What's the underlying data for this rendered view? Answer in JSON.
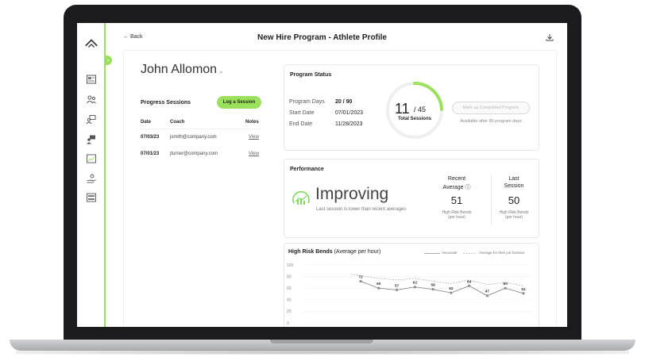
{
  "header": {
    "back_label": "← Back",
    "title": "New Hire Program - Athlete Profile",
    "download_icon": "download-icon"
  },
  "sidebar": {
    "collapse_icon": "chevron-right-icon",
    "accent": "#9be15d",
    "items": [
      {
        "icon": "id-card-icon"
      },
      {
        "icon": "users-icon"
      },
      {
        "icon": "group-icon"
      },
      {
        "icon": "team-icon"
      },
      {
        "icon": "chart-report-icon"
      },
      {
        "icon": "hand-coin-icon"
      },
      {
        "icon": "settings-panel-icon"
      }
    ]
  },
  "athlete": {
    "name": "John Allomon",
    "caret": "⌄"
  },
  "sessions": {
    "title": "Progress Sessions",
    "log_button": "Log a Session",
    "columns": [
      "Date",
      "Coach",
      "Notes"
    ],
    "rows": [
      {
        "date": "07/03/23",
        "coach": "jsmith@company.com",
        "notes": "View"
      },
      {
        "date": "07/01/23",
        "coach": "jturner@company.com",
        "notes": "View"
      }
    ]
  },
  "program_status": {
    "title": "Program Status",
    "days_label": "Program Days",
    "days_value": "20 / 90",
    "start_label": "Start Date",
    "start_value": "07/01/2023",
    "end_label": "End Date",
    "end_value": "11/28/2023",
    "sessions_done": "11",
    "sessions_total": "/ 45",
    "sessions_label": "Total Sessions",
    "sessions_progress": 0.244,
    "complete_button": "Mark as Completed Program",
    "complete_note": "Available after 90 program days"
  },
  "performance": {
    "title": "Performance",
    "status": "Improving",
    "subtitle": "Last session is lower than recent averages",
    "recent_label_1": "Recent",
    "recent_label_2": "Average ⓘ",
    "recent_value": "51",
    "recent_unit_1": "High Risk Bends",
    "recent_unit_2": "(per hour)",
    "last_label_1": "Last",
    "last_label_2": "Session",
    "last_value": "50",
    "last_unit_1": "High Risk Bends",
    "last_unit_2": "(per hour)"
  },
  "bends_chart": {
    "title_bold": "High Risk Bends",
    "title_rest": " (Average per hour)",
    "legend_associate": "Associate",
    "legend_average": "Average for their job function"
  },
  "chart_data": {
    "type": "line",
    "ylim": [
      0,
      100
    ],
    "y_ticks": [
      "100",
      "80",
      "60",
      "40",
      "20",
      "0"
    ],
    "series": [
      {
        "name": "Associate",
        "values": [
          72,
          60,
          57,
          62,
          58,
          52,
          64,
          47,
          60,
          51
        ]
      },
      {
        "name": "Average for their job function",
        "values": [
          84,
          77,
          74,
          77,
          72,
          68,
          74,
          66,
          70,
          64
        ]
      }
    ],
    "point_labels": [
      "72",
      "60",
      "57",
      "62",
      "58",
      "52",
      "64",
      "47",
      "60",
      "51"
    ],
    "colors": {
      "associate": "#8a8d90",
      "average": "#b0b3b6"
    }
  }
}
